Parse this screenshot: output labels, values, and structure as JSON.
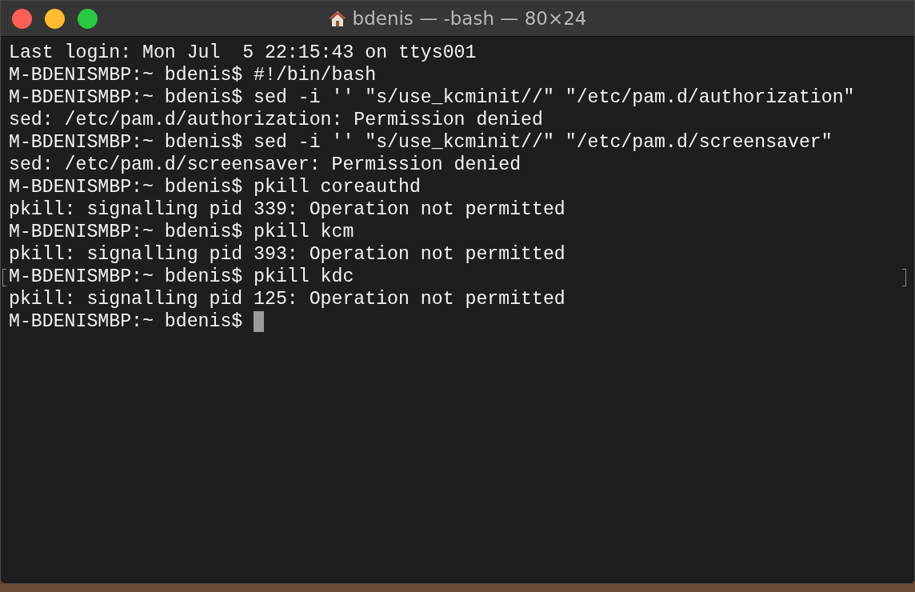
{
  "window": {
    "title": "bdenis — -bash — 80×24"
  },
  "terminal": {
    "lines": [
      {
        "text": "Last login: Mon Jul  5 22:15:43 on ttys001",
        "marked": false,
        "cursor": false
      },
      {
        "text": "M-BDENISMBP:~ bdenis$ #!/bin/bash",
        "marked": false,
        "cursor": false
      },
      {
        "text": "M-BDENISMBP:~ bdenis$ sed -i '' \"s/use_kcminit//\" \"/etc/pam.d/authorization\"",
        "marked": false,
        "cursor": false
      },
      {
        "text": "sed: /etc/pam.d/authorization: Permission denied",
        "marked": false,
        "cursor": false
      },
      {
        "text": "M-BDENISMBP:~ bdenis$ sed -i '' \"s/use_kcminit//\" \"/etc/pam.d/screensaver\"",
        "marked": false,
        "cursor": false
      },
      {
        "text": "sed: /etc/pam.d/screensaver: Permission denied",
        "marked": false,
        "cursor": false
      },
      {
        "text": "M-BDENISMBP:~ bdenis$ pkill coreauthd",
        "marked": false,
        "cursor": false
      },
      {
        "text": "pkill: signalling pid 339: Operation not permitted",
        "marked": false,
        "cursor": false
      },
      {
        "text": "M-BDENISMBP:~ bdenis$ pkill kcm",
        "marked": false,
        "cursor": false
      },
      {
        "text": "pkill: signalling pid 393: Operation not permitted",
        "marked": false,
        "cursor": false
      },
      {
        "text": "M-BDENISMBP:~ bdenis$ pkill kdc",
        "marked": true,
        "cursor": false
      },
      {
        "text": "pkill: signalling pid 125: Operation not permitted",
        "marked": false,
        "cursor": false
      },
      {
        "text": "M-BDENISMBP:~ bdenis$",
        "marked": false,
        "cursor": true
      }
    ]
  }
}
